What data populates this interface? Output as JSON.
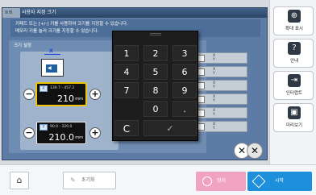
{
  "dialog": {
    "tab": "트레",
    "title": "사용자 지정 크기",
    "info_line1": "키패드 또는 [+/-] 키를 사용하여 크기를 지정할 수 있습니다.",
    "info_line2": "메모리 키를 눌러 크기를 지정할 수 있습니다.",
    "section_title": "크기 설정"
  },
  "size_x": {
    "axis": "X",
    "range": "139.7 - 457.2",
    "value": "210",
    "unit": "mm"
  },
  "size_y": {
    "axis": "Y",
    "range": "90.0 - 320.0",
    "value": "210.0",
    "unit": "mm"
  },
  "paper_icon": {
    "axis_label": "X"
  },
  "memory_list": [
    {
      "x": "X",
      "y": "Y"
    },
    {
      "x": "X",
      "y": "Y"
    },
    {
      "x": "X",
      "y": "Y"
    },
    {
      "x": "X",
      "y": "Y"
    },
    {
      "x": "X",
      "y": "Y"
    },
    {
      "x": "X",
      "y": "Y"
    }
  ],
  "keypad": {
    "keys": [
      "1",
      "2",
      "3",
      "4",
      "5",
      "6",
      "7",
      "8",
      "9",
      "0",
      "."
    ],
    "clear": "C",
    "confirm": "✓"
  },
  "sidebar": {
    "zoom_label": "확대 표시",
    "guide_label": "안내",
    "interrupt_label": "인터럽트",
    "preview_label": "미리보기"
  },
  "bottom": {
    "reset_label": "초기화",
    "stop_label": "정지",
    "start_label": "시작"
  },
  "colors": {
    "start": "#1d8fdb",
    "stop": "#f0a2c1",
    "dialog": "#5c7ca5",
    "keypad": "#1d1d1d"
  }
}
